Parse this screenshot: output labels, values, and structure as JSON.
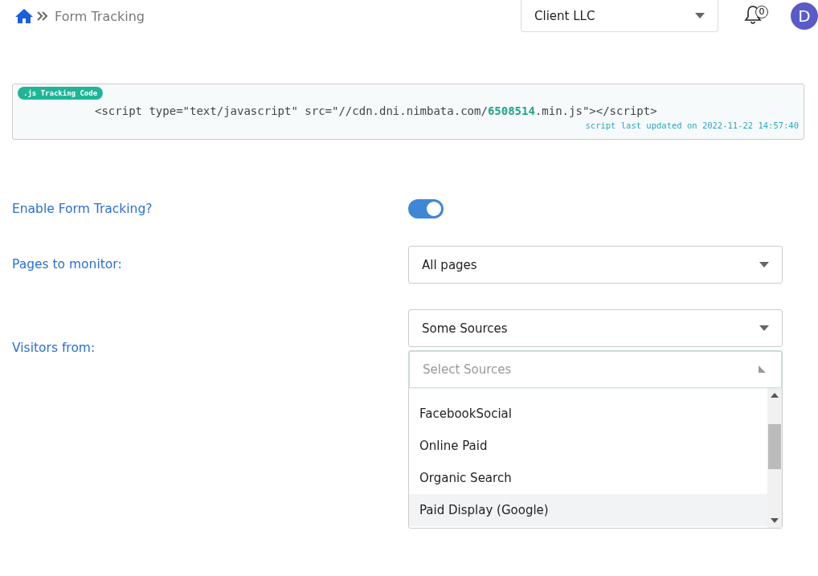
{
  "breadcrumb": {
    "title": "Form Tracking"
  },
  "client_select": {
    "value": "Client LLC"
  },
  "notifications": {
    "count": "0"
  },
  "avatar": {
    "initial": "D"
  },
  "tracking_code": {
    "badge": ".js Tracking Code",
    "code": "<script type=\"text/javascript\" src=\"//cdn.dni.nimbata.com/**6508514**.min.js\"></script>",
    "updated": "script last updated on 2022-11-22 14:57:40"
  },
  "enable_form_tracking": {
    "label": "Enable Form Tracking?",
    "on": true
  },
  "pages_to_monitor": {
    "label": "Pages to monitor:",
    "value": "All pages"
  },
  "visitors_from": {
    "label": "Visitors from:",
    "value": "Some Sources",
    "sources_field": {
      "placeholder": "Select Sources"
    },
    "options": [
      {
        "label": "FacebookSocial",
        "selected": false
      },
      {
        "label": "Online Paid",
        "selected": false
      },
      {
        "label": "Organic Search",
        "selected": false
      },
      {
        "label": "Paid Display (Google)",
        "selected": true
      }
    ]
  }
}
